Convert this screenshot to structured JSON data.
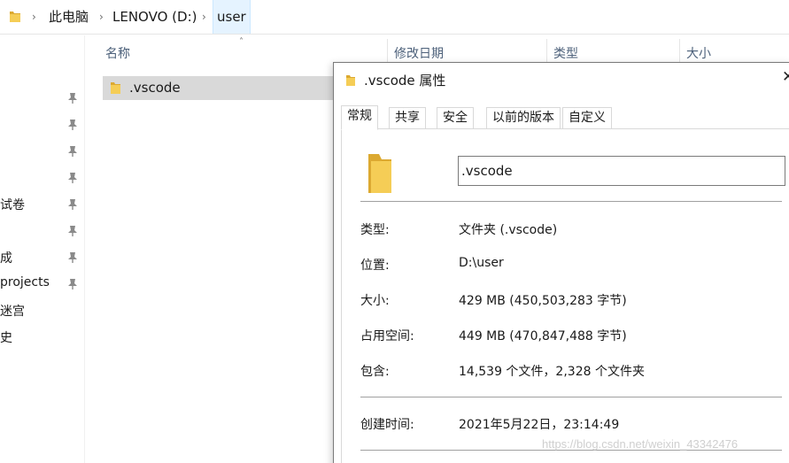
{
  "address_bar": {
    "crumbs": [
      "此电脑",
      "LENOVO (D:)",
      "user"
    ]
  },
  "nav": {
    "items": [
      {
        "label": ""
      },
      {
        "label": ""
      },
      {
        "label": ""
      },
      {
        "label": ""
      },
      {
        "label": "试卷"
      },
      {
        "label": ""
      },
      {
        "label": "成"
      },
      {
        "label": "projects"
      },
      {
        "label": "迷宫"
      },
      {
        "label": "史"
      }
    ]
  },
  "file_list": {
    "columns": [
      "名称",
      "修改日期",
      "类型",
      "大小"
    ],
    "rows": [
      {
        "name": ".vscode"
      }
    ]
  },
  "dialog": {
    "title": ".vscode 属性",
    "close": "✕",
    "tabs": [
      "常规",
      "共享",
      "安全",
      "以前的版本",
      "自定义"
    ],
    "name_value": ".vscode",
    "props": [
      {
        "label": "类型:",
        "value": "文件夹 (.vscode)"
      },
      {
        "label": "位置:",
        "value": "D:\\user"
      },
      {
        "label": "大小:",
        "value": "429 MB (450,503,283 字节)"
      },
      {
        "label": "占用空间:",
        "value": "449 MB (470,847,488 字节)"
      },
      {
        "label": "包含:",
        "value": "14,539 个文件，2,328 个文件夹"
      },
      {
        "label": "创建时间:",
        "value": "2021年5月22日，23:14:49"
      }
    ]
  },
  "watermark": "https://blog.csdn.net/weixin_43342476",
  "colors": {
    "folder": "#f5cd56",
    "folder_dark": "#dca931",
    "selection": "#d9d9d9",
    "breadcrumb_active": "#e5f3ff"
  },
  "icons": {
    "folder": "folder-icon",
    "pin": "pin-icon",
    "close": "close-icon",
    "chevron": "chevron-right-icon",
    "sort": "sort-up-icon"
  }
}
